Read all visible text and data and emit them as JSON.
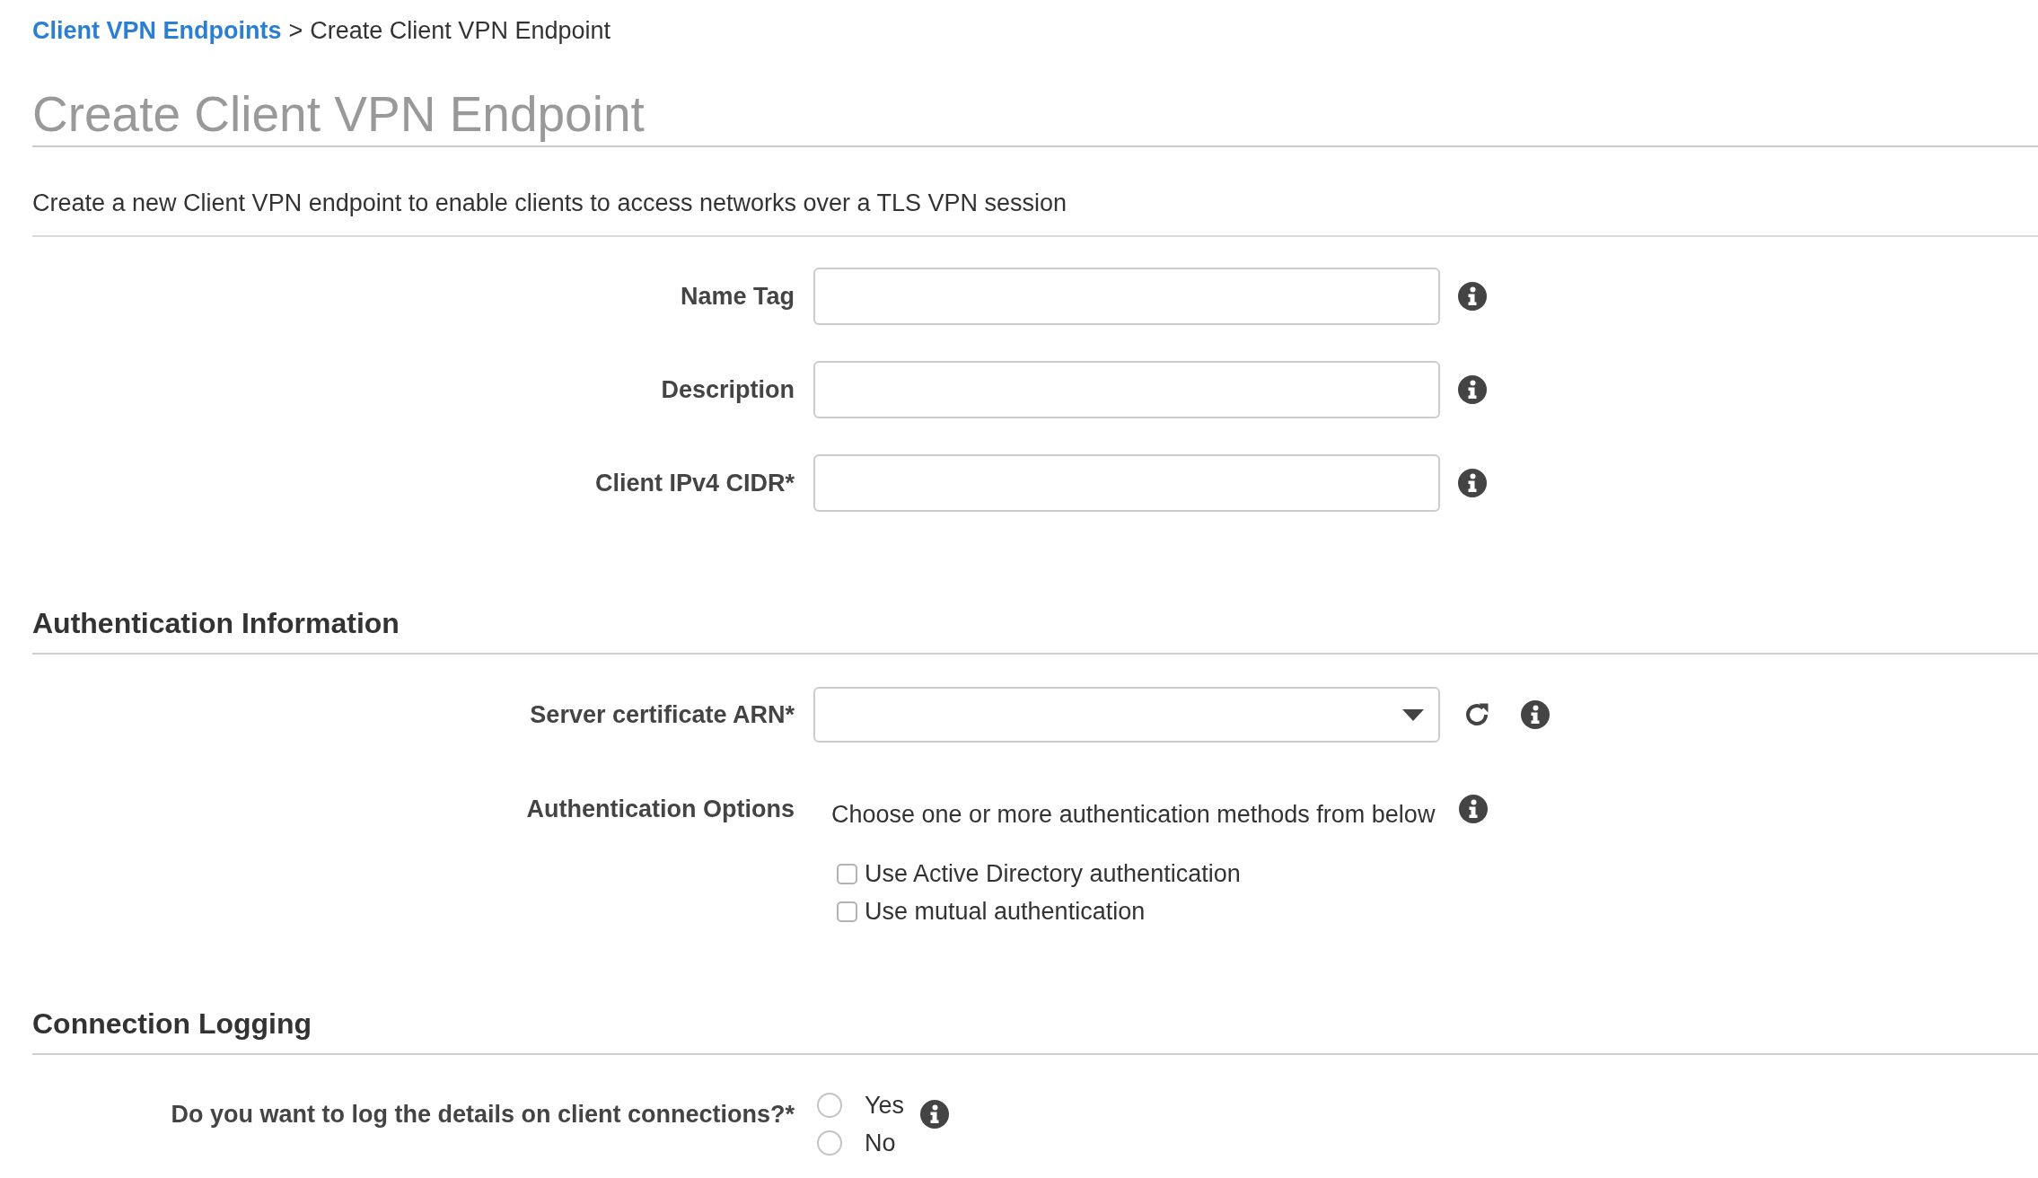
{
  "breadcrumb": {
    "link": "Client VPN Endpoints",
    "separator": ">",
    "current": "Create Client VPN Endpoint"
  },
  "page_title": "Create Client VPN Endpoint",
  "intro": "Create a new Client VPN endpoint to enable clients to access networks over a TLS VPN session",
  "fields": [
    {
      "label": "Name Tag",
      "kind": "text"
    },
    {
      "label": "Description",
      "kind": "text"
    },
    {
      "label": "Client IPv4 CIDR*",
      "kind": "text"
    }
  ],
  "sections": [
    {
      "title": "Authentication Information",
      "fields": [
        {
          "label": "Server certificate ARN*",
          "kind": "select"
        },
        {
          "label": "Authentication Options",
          "kind": "checkboxes",
          "hint": "Choose one or more authentication methods from below",
          "options": [
            {
              "label": "Use Active Directory authentication",
              "checked": false
            },
            {
              "label": "Use mutual authentication",
              "checked": false
            }
          ]
        }
      ]
    },
    {
      "title": "Connection Logging",
      "fields": [
        {
          "label": "Do you want to log the details on client connections?*",
          "kind": "radios",
          "options": [
            {
              "label": "Yes",
              "selected": false
            },
            {
              "label": "No",
              "selected": false
            }
          ]
        }
      ]
    }
  ]
}
